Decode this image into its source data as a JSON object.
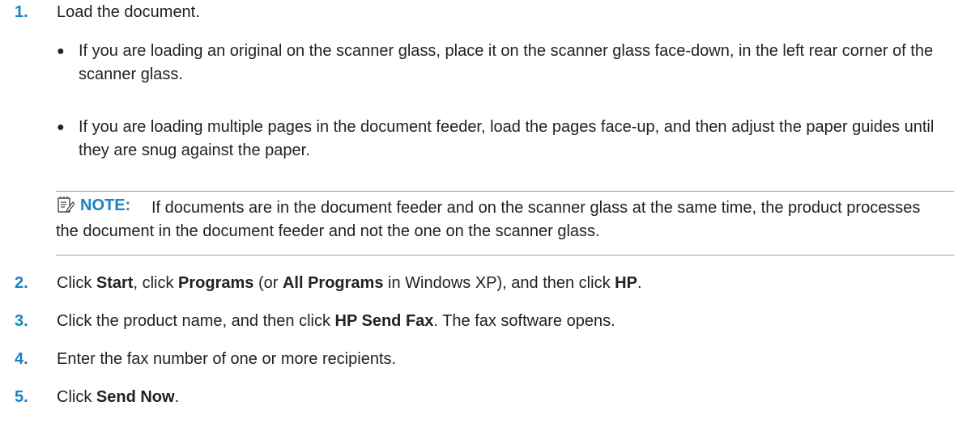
{
  "steps": [
    {
      "number": "1.",
      "text": "Load the document."
    },
    {
      "number": "2.",
      "parts": [
        "Click ",
        "Start",
        ", click ",
        "Programs",
        " (or ",
        "All Programs",
        " in Windows XP), and then click ",
        "HP",
        "."
      ]
    },
    {
      "number": "3.",
      "parts": [
        "Click the product name, and then click ",
        "HP Send Fax",
        ". The fax software opens."
      ]
    },
    {
      "number": "4.",
      "text": "Enter the fax number of one or more recipients."
    },
    {
      "number": "5.",
      "parts": [
        "Click ",
        "Send Now",
        "."
      ]
    }
  ],
  "bullets": [
    {
      "symbol": "●",
      "text": "If you are loading an original on the scanner glass, place it on the scanner glass face-down, in the left rear corner of the scanner glass."
    },
    {
      "symbol": "●",
      "text": "If you are loading multiple pages in the document feeder, load the pages face-up, and then adjust the paper guides until they are snug against the paper."
    }
  ],
  "note": {
    "icon": "note-icon",
    "label": "NOTE:",
    "text": "If documents are in the document feeder and on the scanner glass at the same time, the product processes the document in the document feeder and not the one on the scanner glass."
  },
  "colors": {
    "accent": "#1a82c4",
    "note_rule": "#7aa6d6",
    "text": "#222222"
  }
}
